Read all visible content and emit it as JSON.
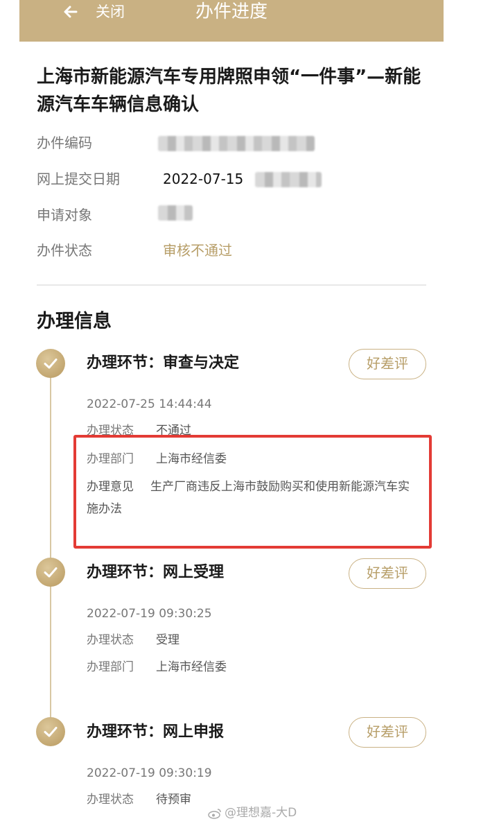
{
  "header": {
    "close_label": "关闭",
    "title": "办件进度"
  },
  "main_title": "上海市新能源汽车专用牌照申领“一件事”—新能源汽车车辆信息确认",
  "info": {
    "case_code_label": "办件编码",
    "submit_date_label": "网上提交日期",
    "submit_date_value": "2022-07-15",
    "applicant_label": "申请对象",
    "status_label": "办件状态",
    "status_value": "审核不通过"
  },
  "section_title": "办理信息",
  "steps": [
    {
      "title": "办理环节：审查与决定",
      "review_label": "好差评",
      "timestamp": "2022-07-25 14:44:44",
      "state_label": "办理状态",
      "state_value": "不通过",
      "dept_label": "办理部门",
      "dept_value": "上海市经信委",
      "opinion_label": "办理意见",
      "opinion_value": "生产厂商违反上海市鼓励购买和使用新能源汽车实施办法"
    },
    {
      "title": "办理环节：网上受理",
      "review_label": "好差评",
      "timestamp": "2022-07-19 09:30:25",
      "state_label": "办理状态",
      "state_value": "受理",
      "dept_label": "办理部门",
      "dept_value": "上海市经信委"
    },
    {
      "title": "办理环节：网上申报",
      "review_label": "好差评",
      "timestamp": "2022-07-19 09:30:19",
      "state_label": "办理状态",
      "state_value": "待预审"
    }
  ],
  "watermark": "@理想嘉-大D",
  "colors": {
    "accent": "#c9b183",
    "status": "#b79e68",
    "highlight": "#e33b35"
  },
  "icons": [
    "back-arrow-icon",
    "check-icon",
    "weibo-icon"
  ]
}
